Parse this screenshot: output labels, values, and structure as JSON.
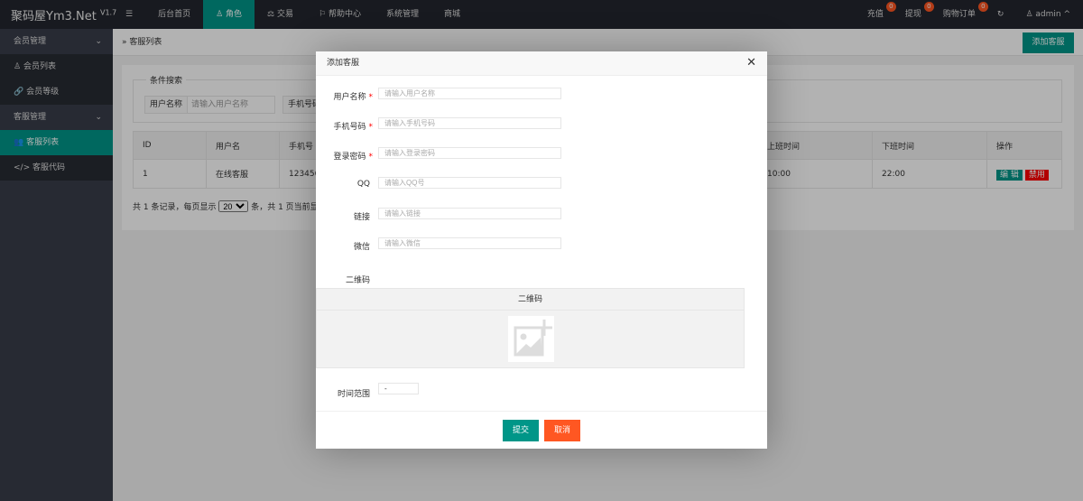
{
  "app": {
    "title": "聚码屋Ym3.Net",
    "version": "V1.7"
  },
  "topnav": {
    "items": [
      "后台首页",
      "角色",
      "交易",
      "帮助中心",
      "系统管理",
      "商城"
    ],
    "active": "角色"
  },
  "topright": {
    "recharge": "充值",
    "recharge_count": "0",
    "withdraw": "提现",
    "withdraw_count": "0",
    "orders": "购物订单",
    "orders_count": "0",
    "user": "admin"
  },
  "sidebar": {
    "groups": [
      {
        "label": "会员管理",
        "items": [
          "会员列表",
          "会员等级"
        ]
      },
      {
        "label": "客服管理",
        "items": [
          "客服列表",
          "客服代码"
        ]
      }
    ],
    "active": "客服列表"
  },
  "breadcrumb": "客服列表",
  "add_button": "添加客服",
  "search": {
    "legend": "条件搜索",
    "username_label": "用户名称",
    "username_placeholder": "请输入用户名称",
    "phone_label": "手机号码"
  },
  "table": {
    "headers": [
      "ID",
      "用户名",
      "手机号",
      "上班时间",
      "下班时间",
      "操作"
    ],
    "rows": [
      {
        "id": "1",
        "username": "在线客服",
        "phone": "123456",
        "start": "10:00",
        "end": "22:00"
      }
    ],
    "edit": "编 辑",
    "disable": "禁用"
  },
  "pagination": {
    "text_before": "共 1 条记录，每页显示",
    "page_size": "20",
    "text_after": "条，共 1 页当前显示第 1 页"
  },
  "modal": {
    "title": "添加客服",
    "fields": [
      {
        "label": "用户名称",
        "required": true,
        "placeholder": "请输入用户名称"
      },
      {
        "label": "手机号码",
        "required": true,
        "placeholder": "请输入手机号码"
      },
      {
        "label": "登录密码",
        "required": true,
        "placeholder": "请输入登录密码"
      },
      {
        "label": "QQ",
        "required": false,
        "placeholder": "请输入QQ号"
      },
      {
        "label": "链接",
        "required": false,
        "placeholder": "请输入链接"
      },
      {
        "label": "微信",
        "required": false,
        "placeholder": "请输入微信"
      }
    ],
    "qr_label": "二维码",
    "qr_header": "二维码",
    "time_label": "时间范围",
    "time_value": "-",
    "submit": "提交",
    "cancel": "取消"
  },
  "colors": {
    "accent": "#009688",
    "danger": "#ff5722",
    "disable": "#ff0000"
  }
}
